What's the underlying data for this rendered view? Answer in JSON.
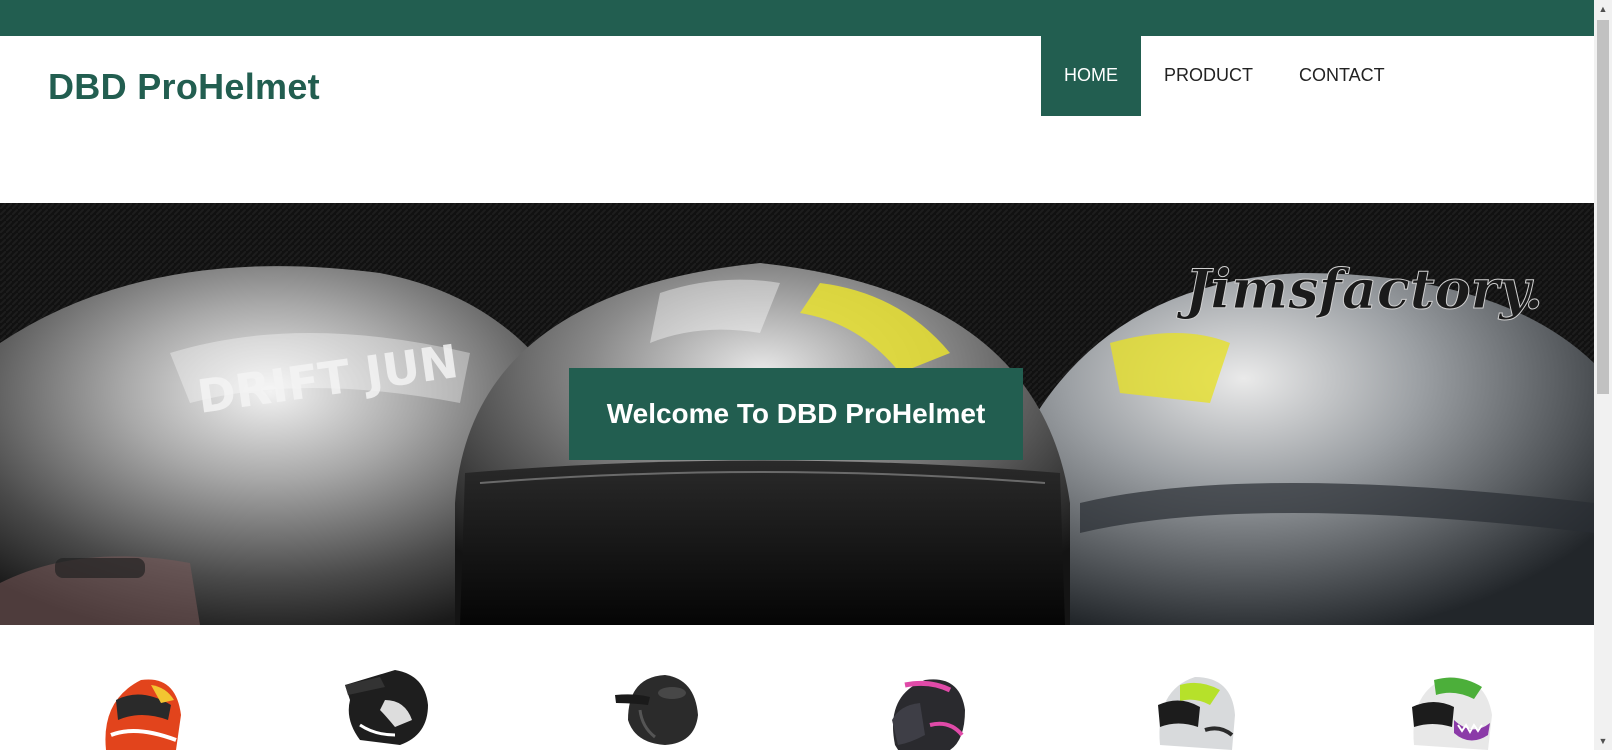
{
  "brand": {
    "title": "DBD ProHelmet"
  },
  "nav": {
    "items": [
      {
        "label": "HOME",
        "active": true
      },
      {
        "label": "PRODUCT",
        "active": false
      },
      {
        "label": "CONTACT",
        "active": false
      }
    ]
  },
  "hero": {
    "welcome": "Welcome To DBD ProHelmet",
    "logo_text": "Jimsfactory.",
    "helmet_text": "DRIFT JUN"
  },
  "products": [
    {
      "name": "red-racing-helmet-icon"
    },
    {
      "name": "motocross-helmet-icon"
    },
    {
      "name": "open-face-helmet-icon"
    },
    {
      "name": "pink-jet-helmet-icon"
    },
    {
      "name": "green-racing-helmet-icon"
    },
    {
      "name": "joker-helmet-icon"
    }
  ],
  "colors": {
    "accent": "#225e50",
    "nav_text": "#222222",
    "white": "#ffffff"
  }
}
